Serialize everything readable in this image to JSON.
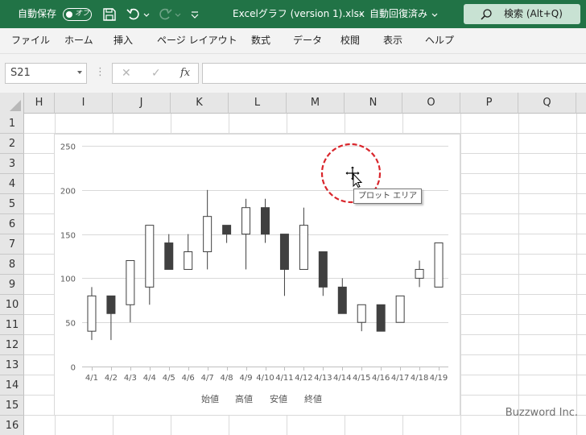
{
  "titlebar": {
    "autosave_label": "自動保存",
    "autosave_state": "オフ",
    "filename": "Excelグラフ (version 1).xlsx",
    "separator": "-",
    "save_status": "自動回復済み",
    "search_label": "検索 (Alt+Q)"
  },
  "ribbon": {
    "tabs": [
      "ファイル",
      "ホーム",
      "挿入",
      "ページ レイアウト",
      "数式",
      "データ",
      "校閲",
      "表示",
      "ヘルプ"
    ]
  },
  "formula_bar": {
    "name_box": "S21",
    "fx_label": "fx",
    "cancel_glyph": "✕",
    "enter_glyph": "✓",
    "formula": ""
  },
  "sheet": {
    "columns": [
      "H",
      "I",
      "J",
      "K",
      "L",
      "M",
      "N",
      "O",
      "P",
      "Q"
    ],
    "rows": [
      "1",
      "2",
      "3",
      "4",
      "5",
      "6",
      "7",
      "8",
      "9",
      "10",
      "11",
      "12",
      "13",
      "14",
      "15",
      "16"
    ]
  },
  "chart_data": {
    "type": "candlestick",
    "categories": [
      "4/1",
      "4/2",
      "4/3",
      "4/4",
      "4/5",
      "4/6",
      "4/7",
      "4/8",
      "4/9",
      "4/10",
      "4/11",
      "4/12",
      "4/13",
      "4/14",
      "4/15",
      "4/16",
      "4/17",
      "4/18",
      "4/19"
    ],
    "series": [
      {
        "name": "始値",
        "values": [
          40,
          80,
          70,
          90,
          140,
          110,
          130,
          160,
          150,
          180,
          150,
          110,
          130,
          90,
          50,
          70,
          50,
          100,
          90
        ]
      },
      {
        "name": "高値",
        "values": [
          90,
          80,
          120,
          160,
          150,
          150,
          200,
          160,
          190,
          190,
          150,
          180,
          130,
          100,
          70,
          70,
          80,
          120,
          140
        ]
      },
      {
        "name": "安値",
        "values": [
          30,
          30,
          50,
          70,
          110,
          110,
          110,
          140,
          110,
          140,
          80,
          110,
          80,
          60,
          40,
          40,
          50,
          90,
          90
        ]
      },
      {
        "name": "終値",
        "values": [
          80,
          60,
          120,
          160,
          110,
          130,
          170,
          150,
          180,
          150,
          110,
          160,
          90,
          60,
          70,
          40,
          80,
          110,
          140
        ]
      }
    ],
    "ylim": [
      0,
      250
    ],
    "yticks": [
      "0",
      "50",
      "100",
      "150",
      "200",
      "250"
    ],
    "grid": true,
    "legend_position": "bottom",
    "up_color": "#ffffff",
    "down_color": "#404040"
  },
  "tooltip": "プロット エリア",
  "watermark": "Buzzword Inc.",
  "colors": {
    "titlebar": "#217346",
    "highlight_circle": "#d9262c"
  }
}
